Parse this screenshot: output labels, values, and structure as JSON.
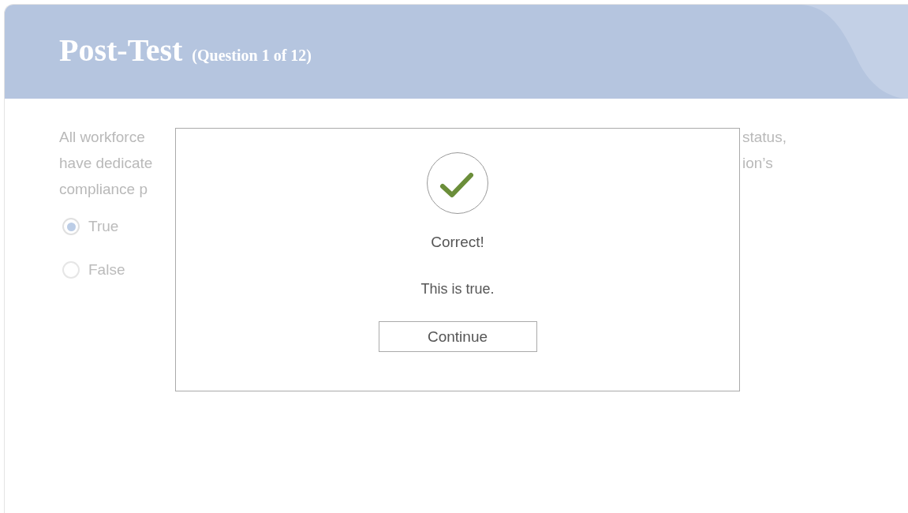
{
  "header": {
    "title": "Post-Test",
    "subtitle": "(Question 1 of 12)"
  },
  "question": {
    "visible_left_lines": [
      "All workforce",
      "have dedicate",
      "compliance p"
    ],
    "visible_right_lines": [
      "status,",
      "ion’s"
    ]
  },
  "options": [
    {
      "label": "True",
      "selected": true
    },
    {
      "label": "False",
      "selected": false
    }
  ],
  "feedback_dialog": {
    "result": "Correct!",
    "message": "This is true.",
    "button": "Continue"
  }
}
